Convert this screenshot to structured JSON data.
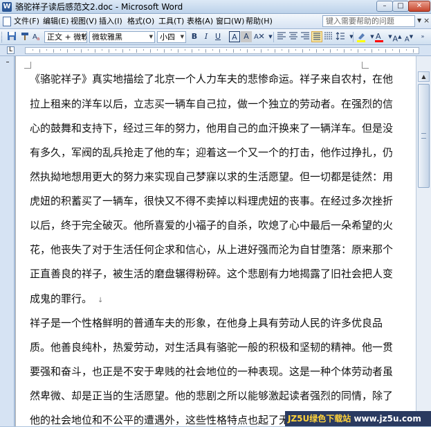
{
  "window": {
    "title": "骆驼祥子读后感范文2.doc - Microsoft Word",
    "controls": {
      "minimize": "–",
      "maximize": "□",
      "close": "✕"
    }
  },
  "menu": {
    "items": [
      "文件(F)",
      "编辑(E)",
      "视图(V)",
      "插入(I)",
      "格式(O)",
      "工具(T)",
      "表格(A)",
      "窗口(W)",
      "帮助(H)"
    ],
    "help_placeholder": "键入需要帮助的问题",
    "close_doc": "×"
  },
  "toolbar": {
    "style_value": "正文 + 微软",
    "font_value": "微软雅黑",
    "size_value": "小四",
    "bold": "B",
    "italic": "I",
    "underline": "U",
    "char_border": "A",
    "char_shade": "A",
    "highlight_color": "#ffff00",
    "font_color": "#ff0000",
    "grow": "A",
    "shrink": "A"
  },
  "ruler": {
    "corner_glyph": "L"
  },
  "document": {
    "lines": [
      "《骆驼祥子》真实地描绘了北京一个人力车夫的悲惨命运。祥子来自农村，在他",
      "拉上租来的洋车以后，立志买一辆车自己拉，做一个独立的劳动者。在强烈的信",
      "心的鼓舞和支持下，经过三年的努力，他用自己的血汗换来了一辆洋车。但是没",
      "有多久，军阀的乱兵抢走了他的车；迎着这一个又一个的打击，他作过挣扎，仍",
      "然执拗地想用更大的努力来实现自己梦寐以求的生活愿望。但一切都是徒然：用",
      "虎妞的积蓄买了一辆车，很快又不得不卖掉以料理虎妞的丧事。在经过多次挫折",
      "以后，终于完全破灭。他所喜爱的小福子的自杀，吹熄了心中最后一朵希望的火",
      "花，他丧失了对于生活任何企求和信心，从上进好强而沦为自甘堕落：原来那个",
      "正直善良的祥子，被生活的磨盘辗得粉碎。这个悲剧有力地揭露了旧社会把人变",
      "成鬼的罪行。",
      "祥子是一个性格鲜明的普通车夫的形象，在他身上具有劳动人民的许多优良品",
      "质。他善良纯朴，热爱劳动，对生活具有骆驼一般的积极和坚韧的精神。他一贯",
      "要强和奋斗，也正是不安于卑贱的社会地位的一种表现。这是一种个体劳动者虽",
      "然卑微、却是正当的生活愿望。他的悲剧之所以能够激起读者强烈的同情，除了",
      "他的社会地位和不公平的遭遇外，这些性格特点也起了无法磨灭的作用。"
    ],
    "para_mark": "↓"
  },
  "watermark": {
    "brand": "JZ5U绿色下载站",
    "url": "www.jz5u.com"
  }
}
